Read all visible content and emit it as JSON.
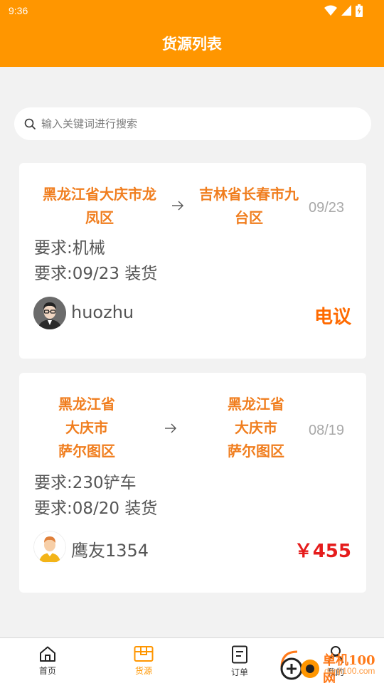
{
  "status_bar": {
    "time": "9:36"
  },
  "header": {
    "title": "货源列表"
  },
  "search": {
    "placeholder": "输入关键词进行搜索"
  },
  "cargo_list": [
    {
      "origin_lines": [
        "黑龙江省大庆市龙",
        "凤区"
      ],
      "destination_lines": [
        "吉林省长春市九",
        "台区"
      ],
      "date": "09/23",
      "requirement_goods": "要求:机械",
      "requirement_loading": "要求:09/23 装货",
      "user_name": "huozhu",
      "price": "电议",
      "price_color": "#ff6a00"
    },
    {
      "origin_lines": [
        "黑龙江省",
        "大庆市",
        "萨尔图区"
      ],
      "destination_lines": [
        "黑龙江省",
        "大庆市",
        "萨尔图区"
      ],
      "date": "08/19",
      "requirement_goods": "要求:230铲车",
      "requirement_loading": "要求:08/20 装货",
      "user_name": "鹰友1354",
      "price": "￥455",
      "price_color": "#e51c1c"
    }
  ],
  "tabbar": {
    "items": [
      {
        "label": "首页",
        "icon": "home-icon",
        "active": false
      },
      {
        "label": "货源",
        "icon": "box-icon",
        "active": true
      },
      {
        "label": "订单",
        "icon": "document-icon",
        "active": false
      },
      {
        "label": "我的",
        "icon": "user-icon",
        "active": false
      }
    ]
  },
  "watermark": {
    "title": "单机100网",
    "url": "danji100.com"
  },
  "colors": {
    "brand": "#ff9600",
    "place_text": "#f07e1f",
    "background": "#f2f2f2"
  }
}
